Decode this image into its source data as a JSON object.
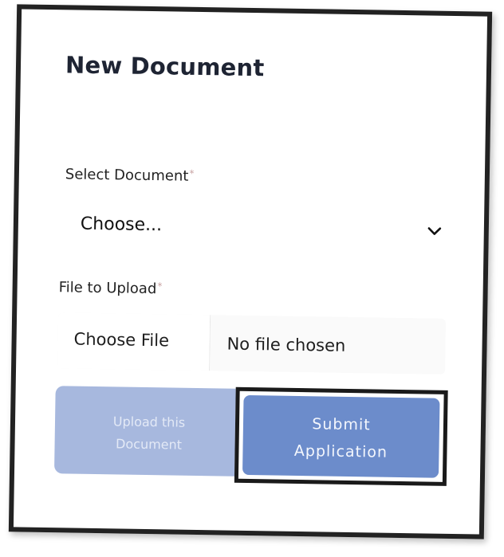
{
  "form": {
    "title": "New Document",
    "select_label": "Select Document",
    "select_required": "*",
    "select_value": "Choose...",
    "file_label": "File to Upload",
    "file_required": "*",
    "file_button_label": "Choose File",
    "file_status": "No file chosen"
  },
  "buttons": {
    "upload_line1": "Upload this",
    "upload_line2": "Document",
    "submit_line1": "Submit",
    "submit_line2": "Application"
  },
  "icons": {
    "select_chevron": "chevron-down-icon"
  },
  "colors": {
    "upload_button_bg": "#a7b8de",
    "submit_button_bg": "#6c8ccb",
    "border": "#222222"
  }
}
